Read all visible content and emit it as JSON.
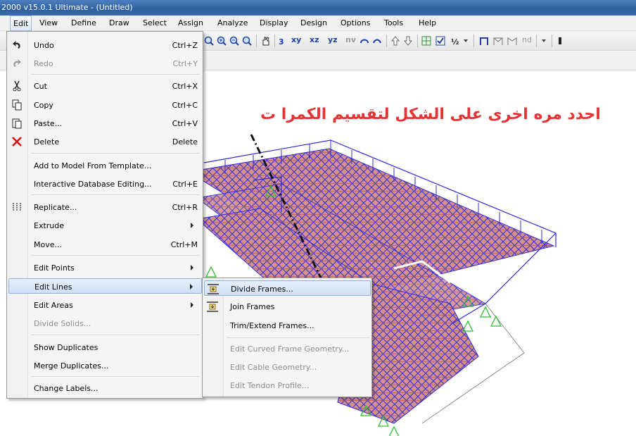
{
  "window": {
    "title": "2000 v15.0.1 Ultimate  - (Untitled)"
  },
  "menubar": {
    "items": [
      "Edit",
      "View",
      "Define",
      "Draw",
      "Select",
      "Assign",
      "Analyze",
      "Display",
      "Design",
      "Options",
      "Tools",
      "Help"
    ]
  },
  "toolbar": {
    "view_labels": [
      "xy",
      "xz",
      "yz",
      "nv"
    ],
    "nd_label": "nd"
  },
  "annotation": {
    "text": "احدد مره اخرى على الشكل لتقسيم الكمرا ت"
  },
  "edit_menu": {
    "items": [
      {
        "label": "Undo",
        "shortcut": "Ctrl+Z",
        "icon": "undo-icon"
      },
      {
        "label": "Redo",
        "shortcut": "Ctrl+Y",
        "icon": "redo-icon",
        "disabled": true
      },
      {
        "label": "Cut",
        "shortcut": "Ctrl+X",
        "icon": "scissors-icon"
      },
      {
        "label": "Copy",
        "shortcut": "Ctrl+C",
        "icon": "copy-icon"
      },
      {
        "label": "Paste...",
        "shortcut": "Ctrl+V",
        "icon": "paste-icon"
      },
      {
        "label": "Delete",
        "shortcut": "Delete",
        "icon": "delete-icon"
      },
      {
        "label": "Add to Model From Template...",
        "shortcut": ""
      },
      {
        "label": "Interactive Database Editing...",
        "shortcut": "Ctrl+E"
      },
      {
        "label": "Replicate...",
        "shortcut": "Ctrl+R",
        "icon": "replicate-icon"
      },
      {
        "label": "Extrude",
        "shortcut": "",
        "submenu": true
      },
      {
        "label": "Move...",
        "shortcut": "Ctrl+M"
      },
      {
        "label": "Edit Points",
        "shortcut": "",
        "submenu": true
      },
      {
        "label": "Edit Lines",
        "shortcut": "",
        "submenu": true,
        "highlighted": true
      },
      {
        "label": "Edit Areas",
        "shortcut": "",
        "submenu": true
      },
      {
        "label": "Divide Solids...",
        "shortcut": "",
        "disabled": true
      },
      {
        "label": "Show Duplicates",
        "shortcut": ""
      },
      {
        "label": "Merge Duplicates...",
        "shortcut": ""
      },
      {
        "label": "Change Labels...",
        "shortcut": ""
      }
    ]
  },
  "edit_lines_submenu": {
    "items": [
      {
        "label": "Divide Frames...",
        "highlighted": true,
        "icon": "divide-frames-icon"
      },
      {
        "label": "Join Frames",
        "icon": "join-frames-icon"
      },
      {
        "label": "Trim/Extend Frames..."
      },
      {
        "label": "Edit Curved Frame Geometry...",
        "disabled": true
      },
      {
        "label": "Edit Cable Geometry...",
        "disabled": true
      },
      {
        "label": "Edit Tendon Profile...",
        "disabled": true
      }
    ]
  },
  "colors": {
    "title_bar": "#3a6aaa",
    "annotation_text": "#e53333",
    "frame_lines": "#2d2de0",
    "slab_fill": "#d8908a",
    "support_green": "#2fbf2f",
    "menu_highlight": "#cfe0f5"
  }
}
